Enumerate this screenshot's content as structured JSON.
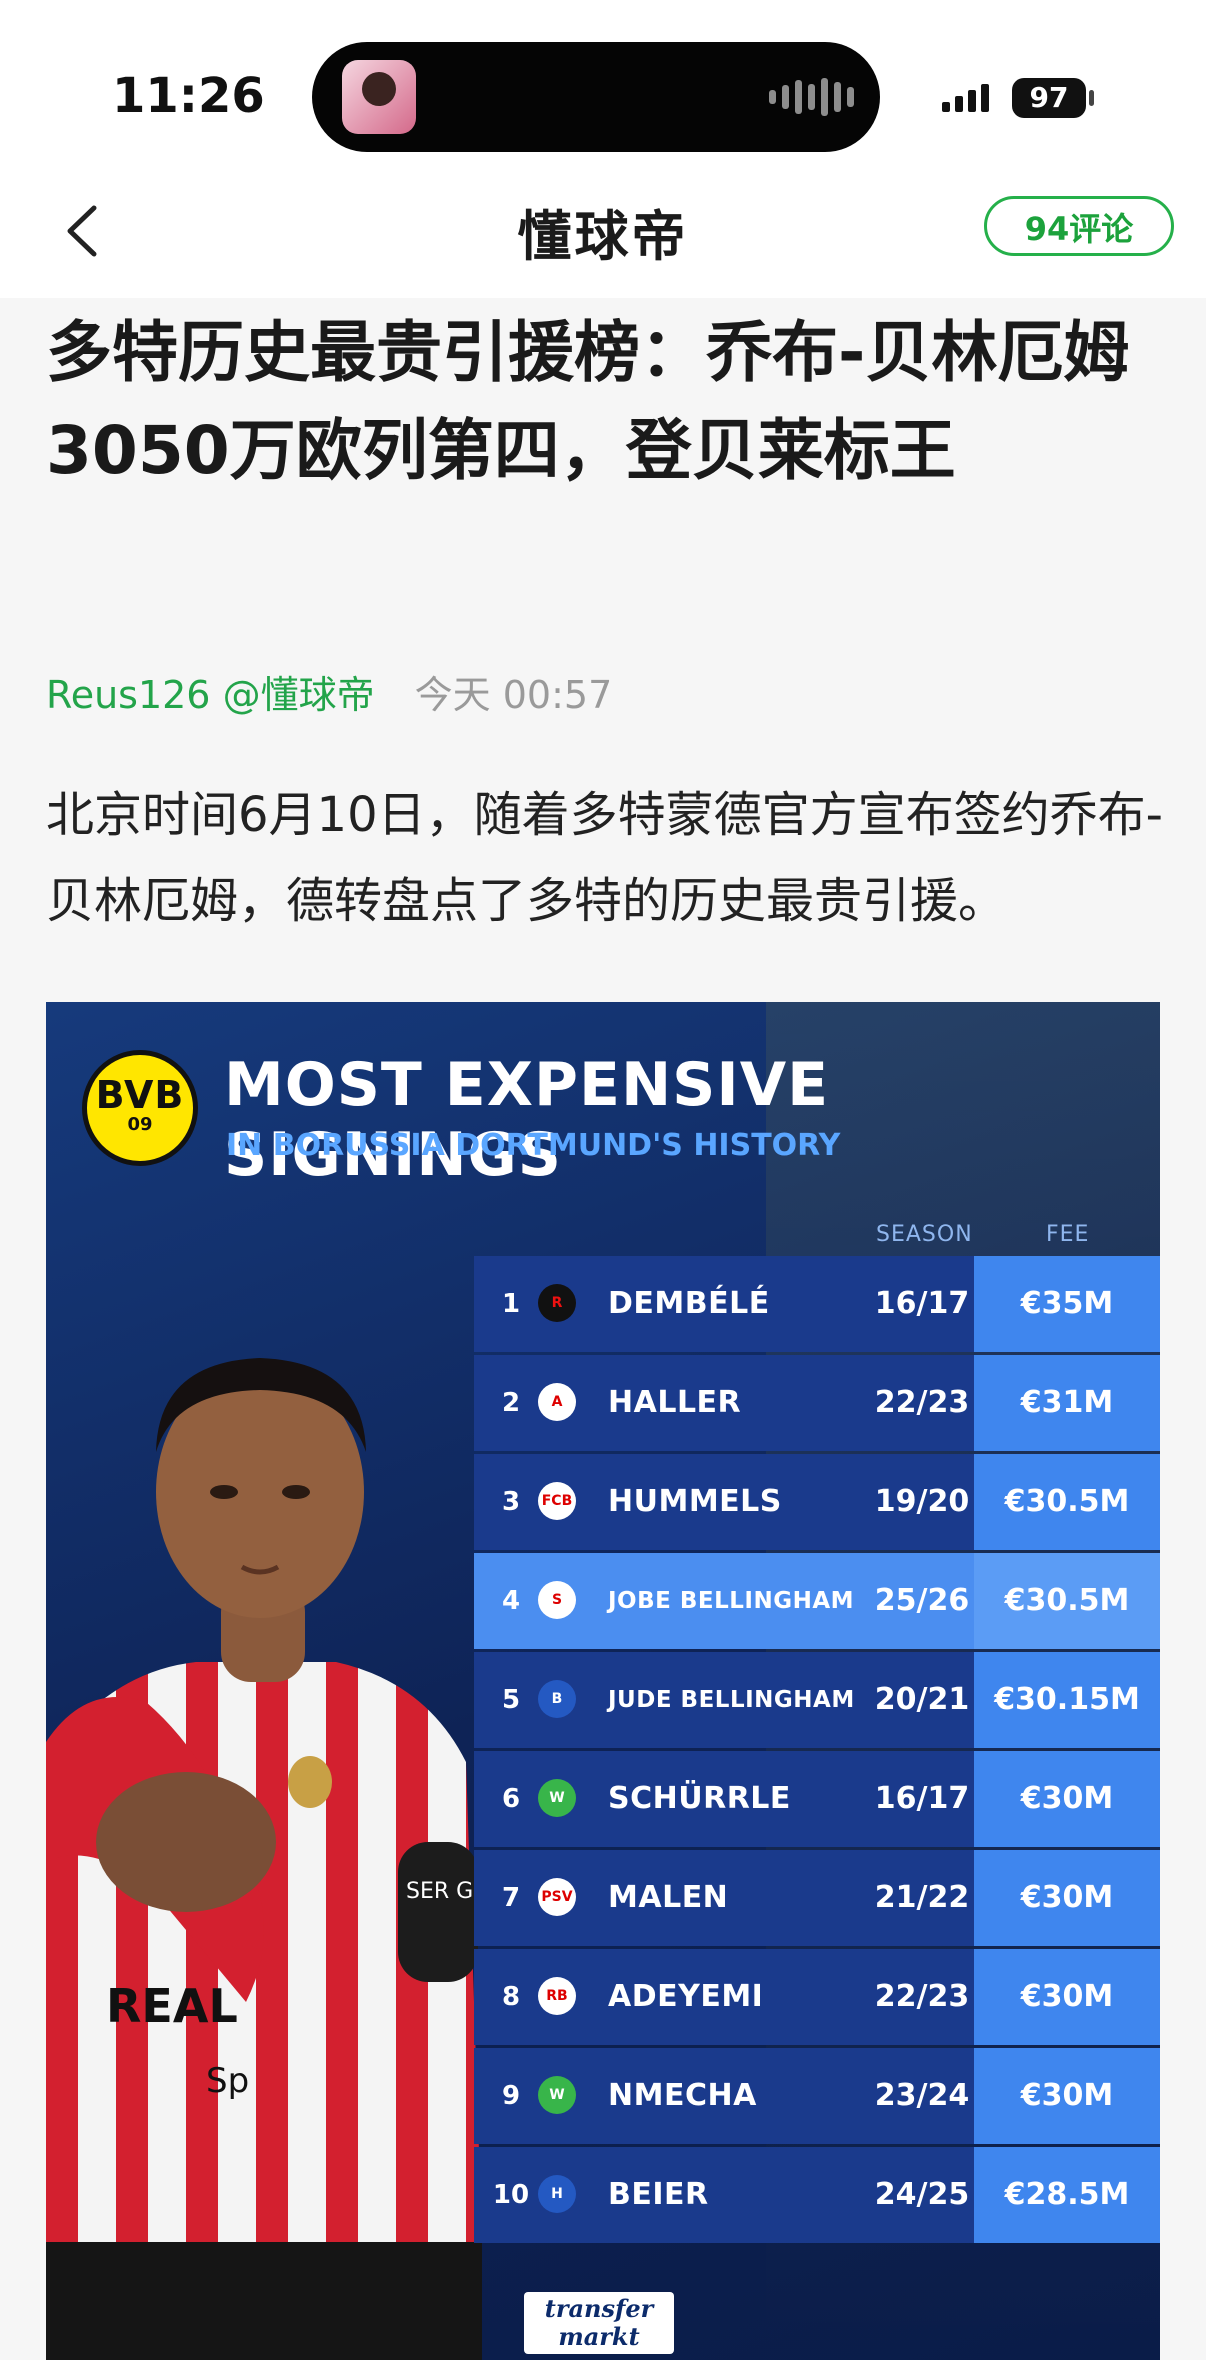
{
  "status": {
    "time": "11:26",
    "battery": "97"
  },
  "nav": {
    "title": "懂球帝",
    "comments": "94评论"
  },
  "article": {
    "title": "多特历史最贵引援榜：乔布-贝林厄姆3050万欧列第四，登贝莱标王",
    "author": "Reus126 @懂球帝",
    "time": "今天 00:57",
    "lead": "北京时间6月10日，随着多特蒙德官方宣布签约乔布-贝林厄姆，德转盘点了多特的历史最贵引援。"
  },
  "graphic": {
    "badge_letters": "BVB",
    "badge_year": "09",
    "title": "MOST EXPENSIVE SIGNINGS",
    "subtitle": "IN BORUSSIA DORTMUND'S HISTORY",
    "col_season": "SEASON",
    "col_fee": "FEE",
    "rows": [
      {
        "rank": "1",
        "name": "DEMBÉLÉ",
        "season": "16/17",
        "fee": "€35M"
      },
      {
        "rank": "2",
        "name": "HALLER",
        "season": "22/23",
        "fee": "€31M"
      },
      {
        "rank": "3",
        "name": "HUMMELS",
        "season": "19/20",
        "fee": "€30.5M"
      },
      {
        "rank": "4",
        "name": "JOBE BELLINGHAM",
        "season": "25/26",
        "fee": "€30.5M"
      },
      {
        "rank": "5",
        "name": "JUDE BELLINGHAM",
        "season": "20/21",
        "fee": "€30.15M"
      },
      {
        "rank": "6",
        "name": "SCHÜRRLE",
        "season": "16/17",
        "fee": "€30M"
      },
      {
        "rank": "7",
        "name": "MALEN",
        "season": "21/22",
        "fee": "€30M"
      },
      {
        "rank": "8",
        "name": "ADEYEMI",
        "season": "22/23",
        "fee": "€30M"
      },
      {
        "rank": "9",
        "name": "NMECHA",
        "season": "23/24",
        "fee": "€30M"
      },
      {
        "rank": "10",
        "name": "BEIER",
        "season": "24/25",
        "fee": "€28.5M"
      }
    ],
    "shirt_text": "REAL",
    "shirt_sponsor": "Sp",
    "armband_text": "SER GRO",
    "logo_line1": "transfer",
    "logo_line2": "markt"
  },
  "colors": {
    "accent_green": "#23a44a",
    "graphic_bg": "#0e2356",
    "fee_cell": "#3f86ee",
    "highlight_row": "#4b8ef0"
  }
}
